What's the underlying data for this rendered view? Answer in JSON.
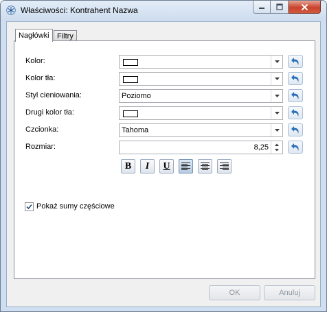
{
  "window": {
    "title": "Właściwości: Kontrahent Nazwa",
    "app_icon": "snowflake-app-icon"
  },
  "tabs": [
    {
      "label": "Nagłówki",
      "active": true
    },
    {
      "label": "Filtry",
      "active": false
    }
  ],
  "fields": {
    "kolor": {
      "label": "Kolor:",
      "swatch_color": "#ffffff"
    },
    "kolor_tla": {
      "label": "Kolor tła:",
      "swatch_color": "#ffffff"
    },
    "styl": {
      "label": "Styl cieniowania:",
      "value": "Poziomo"
    },
    "drugi_kolor": {
      "label": "Drugi kolor tła:",
      "swatch_color": "#ffffff"
    },
    "czcionka": {
      "label": "Czcionka:",
      "value": "Tahoma"
    },
    "rozmiar": {
      "label": "Rozmiar:",
      "value": "8,25"
    }
  },
  "format_buttons": {
    "bold": "B",
    "italic": "I",
    "underline": "U",
    "align_left": "align-left-icon",
    "align_center": "align-center-icon",
    "align_right": "align-right-icon"
  },
  "checkbox": {
    "label": "Pokaż sumy częściowe",
    "checked": true
  },
  "buttons": {
    "ok": "OK",
    "cancel": "Anuluj"
  },
  "colors": {
    "close_button": "#c8432d",
    "title_bar": "#cddcee",
    "reset_icon": "#2a6fb8"
  }
}
